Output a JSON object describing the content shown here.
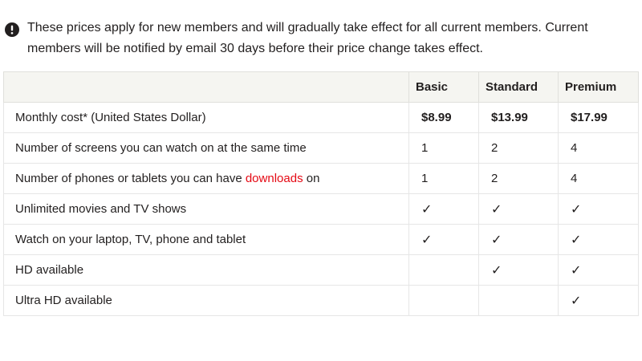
{
  "notice": {
    "icon": "exclamation-circle-icon",
    "text": "These prices apply for new members and will gradually take effect for all current members. Current members will be notified by email 30 days before their price change takes effect."
  },
  "table": {
    "headers": [
      "",
      "Basic",
      "Standard",
      "Premium"
    ],
    "rows": [
      {
        "feature_before": "Monthly cost* (United States Dollar)",
        "link": "",
        "feature_after": "",
        "basic": "$8.99",
        "standard": "$13.99",
        "premium": "$17.99"
      },
      {
        "feature_before": "Number of screens you can watch on at the same time",
        "link": "",
        "feature_after": "",
        "basic": "1",
        "standard": "2",
        "premium": "4"
      },
      {
        "feature_before": "Number of phones or tablets you can have ",
        "link": "downloads",
        "feature_after": " on",
        "basic": "1",
        "standard": "2",
        "premium": "4"
      },
      {
        "feature_before": "Unlimited movies and TV shows",
        "link": "",
        "feature_after": "",
        "basic": "✓",
        "standard": "✓",
        "premium": "✓"
      },
      {
        "feature_before": "Watch on your laptop, TV, phone and tablet",
        "link": "",
        "feature_after": "",
        "basic": "✓",
        "standard": "✓",
        "premium": "✓"
      },
      {
        "feature_before": "HD available",
        "link": "",
        "feature_after": "",
        "basic": "",
        "standard": "✓",
        "premium": "✓"
      },
      {
        "feature_before": "Ultra HD available",
        "link": "",
        "feature_after": "",
        "basic": "",
        "standard": "",
        "premium": "✓"
      }
    ]
  },
  "colors": {
    "text": "#221f1f",
    "link": "#e50914",
    "header_bg": "#f5f5f1",
    "border": "#e6e6e6"
  }
}
